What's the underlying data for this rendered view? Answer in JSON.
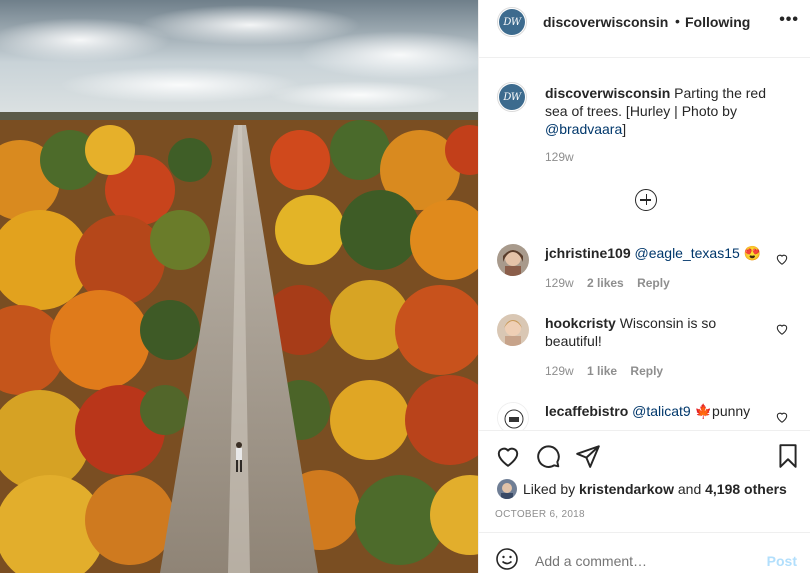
{
  "post": {
    "username": "discoverwisconsin",
    "logo_text": "DW",
    "separator": "•",
    "follow_status": "Following",
    "more_glyph": "•••",
    "caption_user": "discoverwisconsin",
    "caption_text": " Parting the red sea of trees. [Hurley | Photo by ",
    "caption_mention": "@bradvaara",
    "caption_end": "]",
    "caption_age": "129w"
  },
  "comments": [
    {
      "user": "jchristine109",
      "mention": "@eagle_texas15",
      "text": " 😍",
      "age": "129w",
      "likes": "2 likes",
      "reply": "Reply"
    },
    {
      "user": "hookcristy",
      "mention": "",
      "text": " Wisconsin is so beautiful!",
      "age": "129w",
      "likes": "1 like",
      "reply": "Reply"
    },
    {
      "user": "lecaffebistro",
      "mention": "@talicat9",
      "text": " 🍁punny",
      "age": "",
      "likes": "",
      "reply": ""
    }
  ],
  "likes": {
    "prefix": "Liked by ",
    "user": "kristendarkow",
    "middle": " and ",
    "count": "4,198 others"
  },
  "date": "OCTOBER 6, 2018",
  "add_comment": {
    "placeholder": "Add a comment…",
    "post_label": "Post"
  },
  "icons": {
    "heart": "heart-icon",
    "comment": "comment-icon",
    "share": "paper-plane-icon",
    "save": "bookmark-icon",
    "emoji": "smiley-icon",
    "load_more": "plus-circle-icon"
  },
  "colors": {
    "link": "#00376b",
    "muted": "#8e8e8e",
    "post_disabled": "#b2dffc"
  }
}
